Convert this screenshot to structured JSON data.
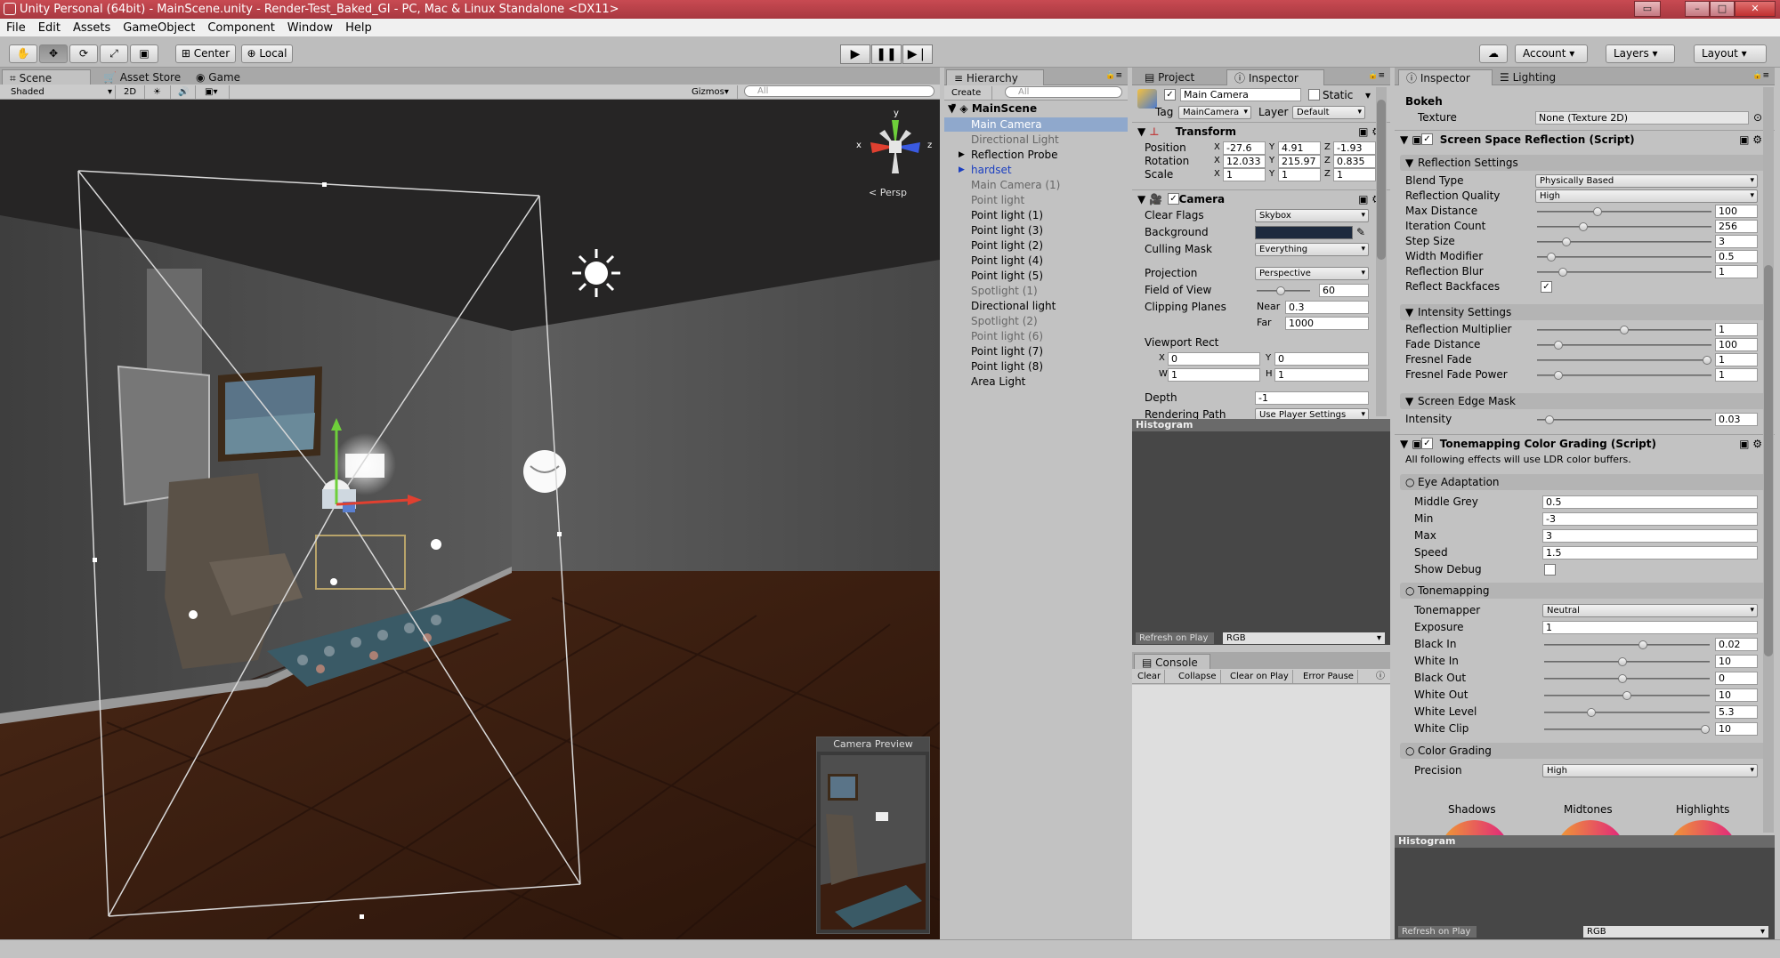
{
  "window": {
    "title": "Unity Personal (64bit) - MainScene.unity - Render-Test_Baked_GI - PC, Mac & Linux Standalone <DX11>"
  },
  "menu": [
    "File",
    "Edit",
    "Assets",
    "GameObject",
    "Component",
    "Window",
    "Help"
  ],
  "toolbar": {
    "center": "Center",
    "local": "Local",
    "account": "Account",
    "layers": "Layers",
    "layout": "Layout"
  },
  "scene": {
    "tabs": [
      "Scene",
      "Asset Store",
      "Game"
    ],
    "shading": "Shaded",
    "mode_2d": "2D",
    "gizmos": "Gizmos",
    "search_placeholder": "All",
    "persp": "< Persp",
    "camera_preview": "Camera Preview"
  },
  "hierarchy": {
    "tab": "Hierarchy",
    "create": "Create",
    "search_placeholder": "All",
    "root": "MainScene",
    "items": [
      "Main Camera",
      "Directional Light",
      "Reflection Probe",
      "hardset",
      "Main Camera (1)",
      "Point light",
      "Point light (1)",
      "Point light (3)",
      "Point light (2)",
      "Point light (4)",
      "Point light (5)",
      "Spotlight (1)",
      "Directional light",
      "Spotlight (2)",
      "Point light (6)",
      "Point light (7)",
      "Point light (8)",
      "Area Light"
    ]
  },
  "inspector": {
    "tabs": [
      "Project",
      "Inspector"
    ],
    "name": "Main Camera",
    "static": "Static",
    "tag_label": "Tag",
    "tag": "MainCamera",
    "layer_label": "Layer",
    "layer": "Default",
    "transform": {
      "title": "Transform",
      "position": "Position",
      "rotation": "Rotation",
      "scale": "Scale",
      "pos": [
        "-27.6",
        "4.91",
        "-1.93"
      ],
      "rot": [
        "12.033",
        "215.97",
        "0.835"
      ],
      "scl": [
        "1",
        "1",
        "1"
      ]
    },
    "camera": {
      "title": "Camera",
      "clear_flags": "Clear Flags",
      "clear_flags_v": "Skybox",
      "background": "Background",
      "culling_mask": "Culling Mask",
      "culling_mask_v": "Everything",
      "projection": "Projection",
      "projection_v": "Perspective",
      "fov": "Field of View",
      "fov_v": "60",
      "clipping": "Clipping Planes",
      "near": "Near",
      "near_v": "0.3",
      "far": "Far",
      "far_v": "1000",
      "viewport": "Viewport Rect",
      "vx": "0",
      "vy": "0",
      "vw": "1",
      "vh": "1",
      "depth": "Depth",
      "depth_v": "-1",
      "rendering_path": "Rendering Path",
      "rendering_path_v": "Use Player Settings"
    },
    "histogram": "Histogram",
    "refresh_on_play": "Refresh on Play",
    "rgb": "RGB"
  },
  "console": {
    "tab": "Console",
    "buttons": [
      "Clear",
      "Collapse",
      "Clear on Play",
      "Error Pause"
    ]
  },
  "inspector2": {
    "tabs": [
      "Inspector",
      "Lighting"
    ],
    "bokeh": "Bokeh",
    "texture": "Texture",
    "texture_v": "None (Texture 2D)",
    "ssr": {
      "title": "Screen Space Reflection (Script)",
      "reflection_settings": "Reflection Settings",
      "rows": [
        {
          "label": "Blend Type",
          "type": "drop",
          "value": "Physically Based"
        },
        {
          "label": "Reflection Quality",
          "type": "drop",
          "value": "High"
        },
        {
          "label": "Max Distance",
          "type": "slider",
          "value": "100",
          "t": 0.34
        },
        {
          "label": "Iteration Count",
          "type": "slider",
          "value": "256",
          "t": 0.25
        },
        {
          "label": "Step Size",
          "type": "slider",
          "value": "3",
          "t": 0.15
        },
        {
          "label": "Width Modifier",
          "type": "slider",
          "value": "0.5",
          "t": 0.06
        },
        {
          "label": "Reflection Blur",
          "type": "slider",
          "value": "1",
          "t": 0.13
        },
        {
          "label": "Reflect Backfaces",
          "type": "check",
          "value": "✓"
        }
      ],
      "intensity_settings": "Intensity Settings",
      "rows2": [
        {
          "label": "Reflection Multiplier",
          "type": "slider",
          "value": "1",
          "t": 0.5
        },
        {
          "label": "Fade Distance",
          "type": "slider",
          "value": "100",
          "t": 0.1
        },
        {
          "label": "Fresnel Fade",
          "type": "slider",
          "value": "1",
          "t": 1.0
        },
        {
          "label": "Fresnel Fade Power",
          "type": "slider",
          "value": "1",
          "t": 0.1
        }
      ],
      "screen_edge_mask": "Screen Edge Mask",
      "intensity": "Intensity",
      "intensity_v": "0.03",
      "intensity_t": 0.05
    },
    "tcg": {
      "title": "Tonemapping Color Grading (Script)",
      "note": "All following effects will use LDR color buffers.",
      "eye": "Eye Adaptation",
      "middle_grey": "Middle Grey",
      "middle_grey_v": "0.5",
      "min": "Min",
      "min_v": "-3",
      "max": "Max",
      "max_v": "3",
      "speed": "Speed",
      "speed_v": "1.5",
      "show_debug": "Show Debug",
      "tonemapping": "Tonemapping",
      "tonemapper": "Tonemapper",
      "tonemapper_v": "Neutral",
      "rows": [
        {
          "label": "Exposure",
          "type": "field",
          "value": "1"
        },
        {
          "label": "Black In",
          "type": "slider",
          "value": "0.02",
          "t": 0.6
        },
        {
          "label": "White In",
          "type": "slider",
          "value": "10",
          "t": 0.47
        },
        {
          "label": "Black Out",
          "type": "slider",
          "value": "0",
          "t": 0.47
        },
        {
          "label": "White Out",
          "type": "slider",
          "value": "10",
          "t": 0.5
        },
        {
          "label": "White Level",
          "type": "slider",
          "value": "5.3",
          "t": 0.27
        },
        {
          "label": "White Clip",
          "type": "slider",
          "value": "10",
          "t": 1.0
        }
      ],
      "color_grading": "Color Grading",
      "precision": "Precision",
      "precision_v": "High",
      "wheels": [
        "Shadows",
        "Midtones",
        "Highlights"
      ]
    },
    "histogram": "Histogram",
    "refresh_on_play": "Refresh on Play",
    "rgb": "RGB"
  },
  "colors": {
    "title_red": "#b8424a",
    "camera_bg": "#1d2a3e",
    "wood": "#3a1e10",
    "wall": "#575757"
  }
}
